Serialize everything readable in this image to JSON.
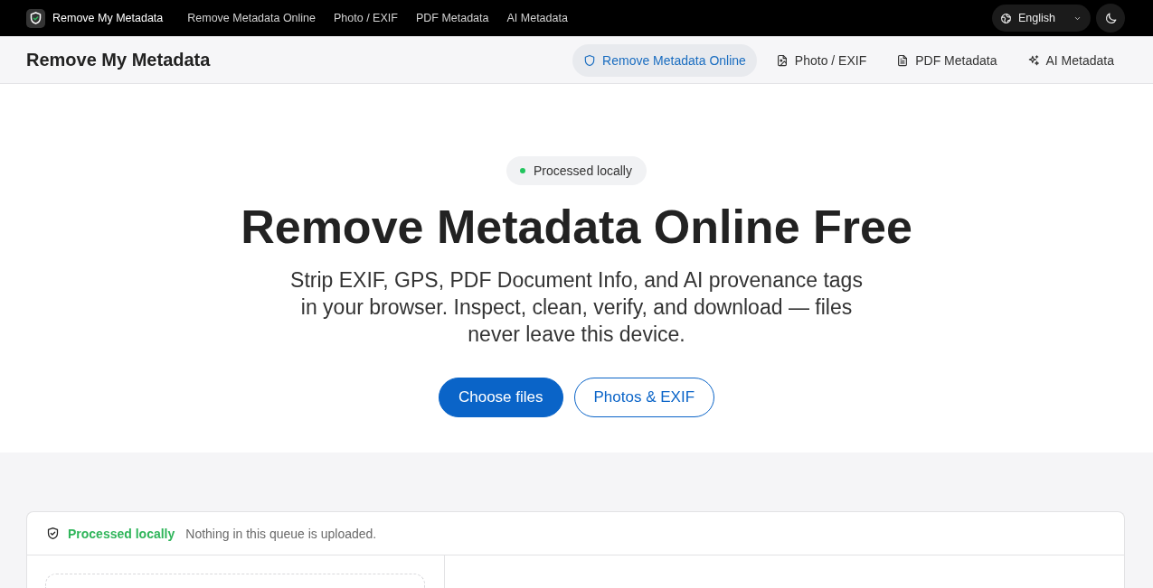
{
  "top_bar": {
    "brand": "Remove My Metadata",
    "links": [
      "Remove Metadata Online",
      "Photo / EXIF",
      "PDF Metadata",
      "AI Metadata"
    ],
    "language": "English"
  },
  "header": {
    "title": "Remove My Metadata",
    "nav": [
      {
        "label": "Remove Metadata Online",
        "selected": true
      },
      {
        "label": "Photo / EXIF",
        "selected": false
      },
      {
        "label": "PDF Metadata",
        "selected": false
      },
      {
        "label": "AI Metadata",
        "selected": false
      }
    ]
  },
  "hero": {
    "badge": "Processed locally",
    "title": "Remove Metadata Online Free",
    "subtitle": "Strip EXIF, GPS, PDF Document Info, and AI provenance tags in your browser. Inspect, clean, verify, and download — files never leave this device.",
    "buttons": [
      {
        "label": "Choose files",
        "kind": "primary"
      },
      {
        "label": "Photos & EXIF",
        "kind": "outline"
      }
    ]
  },
  "queue": {
    "status": "Processed locally",
    "note": "Nothing in this queue is uploaded."
  }
}
